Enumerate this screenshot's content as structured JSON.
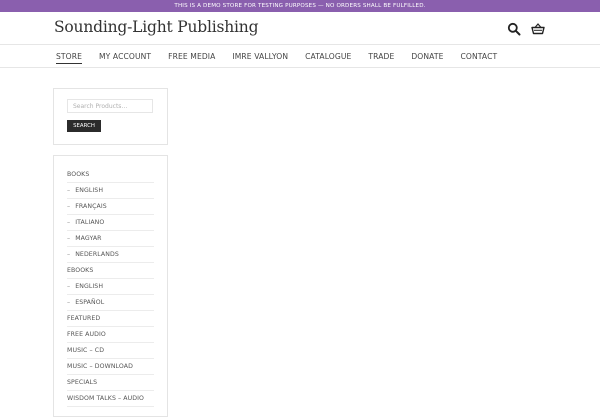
{
  "notice": "This is a demo store for testing purposes — no orders shall be fulfilled.",
  "site": {
    "title": "Sounding-Light Publishing"
  },
  "header": {
    "search_icon": "search-icon",
    "cart_icon": "basket-icon"
  },
  "nav": [
    {
      "label": "Store",
      "active": true
    },
    {
      "label": "My Account"
    },
    {
      "label": "Free Media"
    },
    {
      "label": "Imre Vallyon"
    },
    {
      "label": "Catalogue"
    },
    {
      "label": "Trade"
    },
    {
      "label": "Donate"
    },
    {
      "label": "Contact"
    }
  ],
  "search": {
    "placeholder": "Search Products…",
    "button_label": "Search"
  },
  "categories": [
    {
      "label": "Books"
    },
    {
      "label": "English",
      "child": true
    },
    {
      "label": "Français",
      "child": true
    },
    {
      "label": "Italiano",
      "child": true
    },
    {
      "label": "Magyar",
      "child": true
    },
    {
      "label": "Nederlands",
      "child": true
    },
    {
      "label": "eBooks"
    },
    {
      "label": "English",
      "child": true
    },
    {
      "label": "Español",
      "child": true
    },
    {
      "label": "Featured"
    },
    {
      "label": "Free Audio"
    },
    {
      "label": "Music – CD"
    },
    {
      "label": "Music – Download"
    },
    {
      "label": "Specials"
    },
    {
      "label": "Wisdom Talks – Audio"
    }
  ],
  "colors": {
    "notice_bg": "#8a5fae",
    "button_bg": "#2b2b2b"
  }
}
